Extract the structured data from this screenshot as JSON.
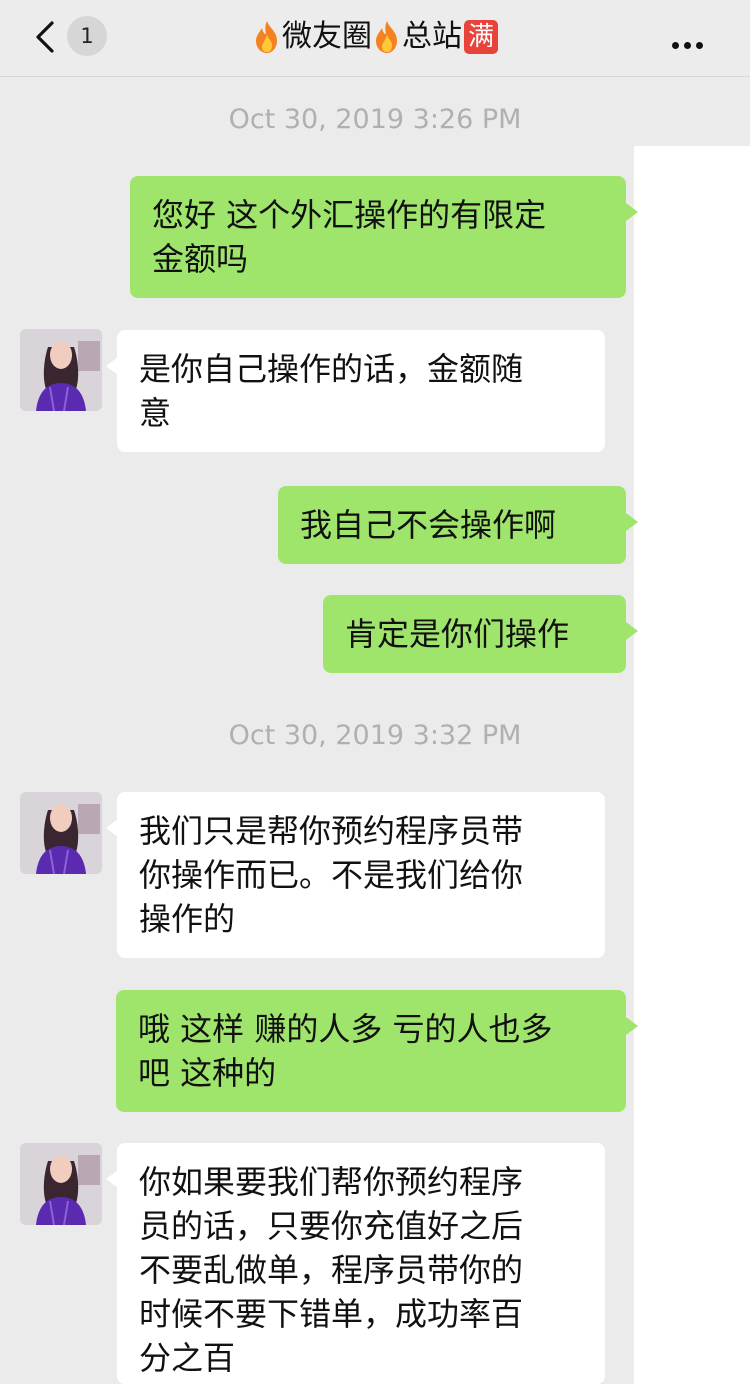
{
  "header": {
    "back_count": "1",
    "title": "微友圈",
    "title_suffix": "总站",
    "badge": "满"
  },
  "messages": [
    {
      "type": "time",
      "text": "Oct 30, 2019 3:26 PM"
    },
    {
      "type": "sent",
      "text": "您好 这个外汇操作的有限定\n金额吗"
    },
    {
      "type": "received",
      "text": "是你自己操作的话，金额随\n意"
    },
    {
      "type": "sent",
      "text": "我自己不会操作啊"
    },
    {
      "type": "sent",
      "text": "肯定是你们操作"
    },
    {
      "type": "time",
      "text": "Oct 30, 2019 3:32 PM"
    },
    {
      "type": "received",
      "text": "我们只是帮你预约程序员带\n你操作而已。不是我们给你\n操作的"
    },
    {
      "type": "sent",
      "text": "哦 这样 赚的人多 亏的人也多\n吧 这种的"
    },
    {
      "type": "received",
      "text": "你如果要我们帮你预约程序\n员的话，只要你充值好之后\n不要乱做单，程序员带你的\n时候不要下错单，成功率百\n分之百"
    }
  ],
  "colors": {
    "sent_bubble": "#9fe56b",
    "received_bubble": "#ffffff",
    "background": "#ebebeb",
    "badge": "#e8423a"
  },
  "icons": {
    "back": "chevron-left-icon",
    "title_decoration": "fire-icon",
    "more": "more-dots-icon"
  }
}
